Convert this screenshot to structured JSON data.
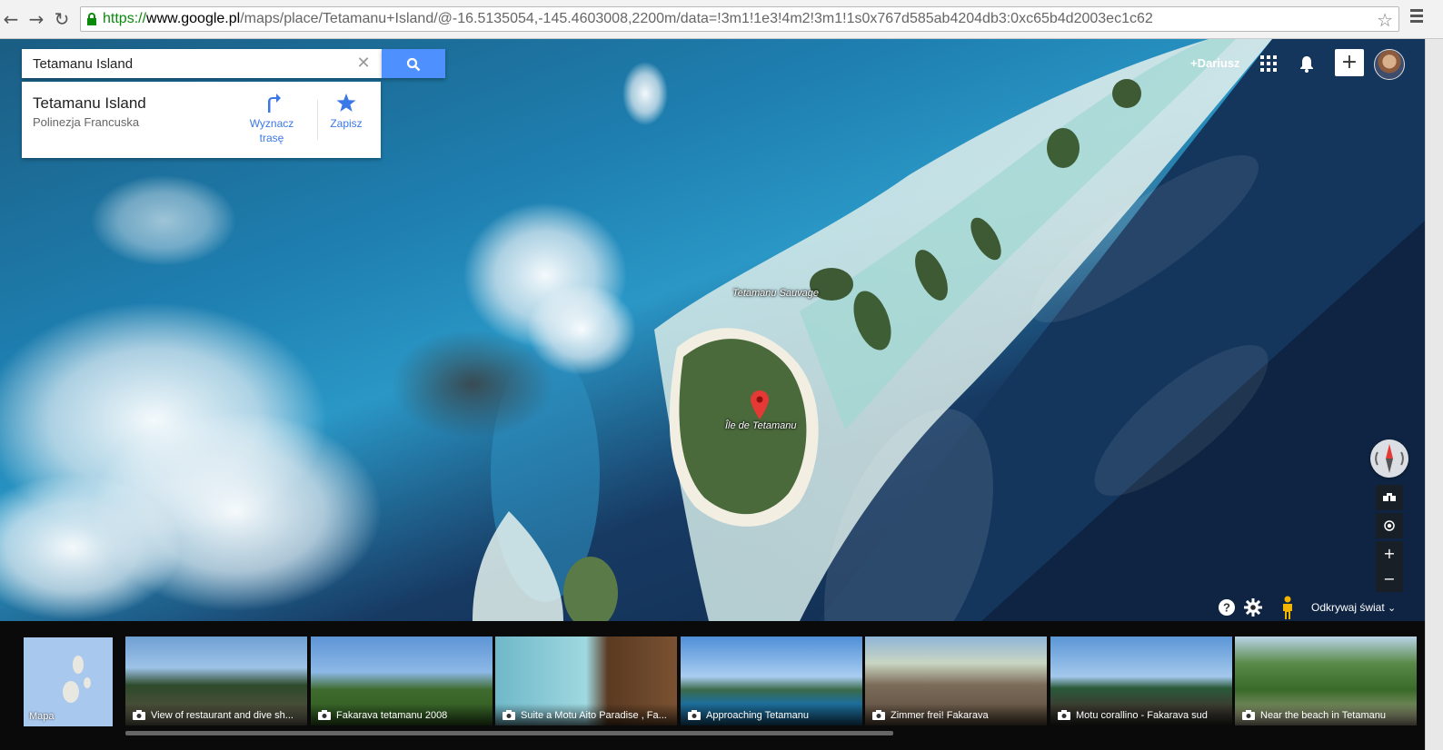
{
  "browser": {
    "url_proto": "https://",
    "url_host": "www.google.pl",
    "url_path": "/maps/place/Tetamanu+Island/@-16.5135054,-145.4603008,2200m/data=!3m1!1e3!4m2!3m1!1s0x767d585ab4204db3:0xc65b4d2003ec1c62",
    "back_glyph": "←",
    "forward_glyph": "→",
    "reload_glyph": "↻",
    "star_glyph": "☆"
  },
  "search": {
    "value": "Tetamanu Island",
    "clear_glyph": "✕"
  },
  "place_card": {
    "title": "Tetamanu Island",
    "subtitle": "Polinezja Francuska",
    "directions_label_1": "Wyznacz",
    "directions_label_2": "trasę",
    "save_label": "Zapisz"
  },
  "account": {
    "user_name": "+Dariusz",
    "share_glyph": "+"
  },
  "map": {
    "labels": {
      "sauvage": "Tetamanu Sauvage",
      "ile": "Île de Tetamanu"
    }
  },
  "controls": {
    "zoom_in": "+",
    "zoom_out": "−",
    "explore_label": "Odkrywaj świat"
  },
  "filmstrip": {
    "map_label": "Mapa",
    "photos": [
      {
        "caption": "View of restaurant and dive sh..."
      },
      {
        "caption": "Fakarava tetamanu 2008"
      },
      {
        "caption": "Suite a Motu Aito Paradise , Fa..."
      },
      {
        "caption": "Approaching Tetamanu"
      },
      {
        "caption": "Zimmer frei! Fakarava"
      },
      {
        "caption": "Motu corallino - Fakarava sud"
      },
      {
        "caption": "Near the beach in Tetamanu"
      }
    ]
  },
  "colors": {
    "accent_blue": "#4d90fe",
    "link_blue": "#3b78e7",
    "marker_red": "#e53935",
    "url_green": "#0a8a0a"
  }
}
